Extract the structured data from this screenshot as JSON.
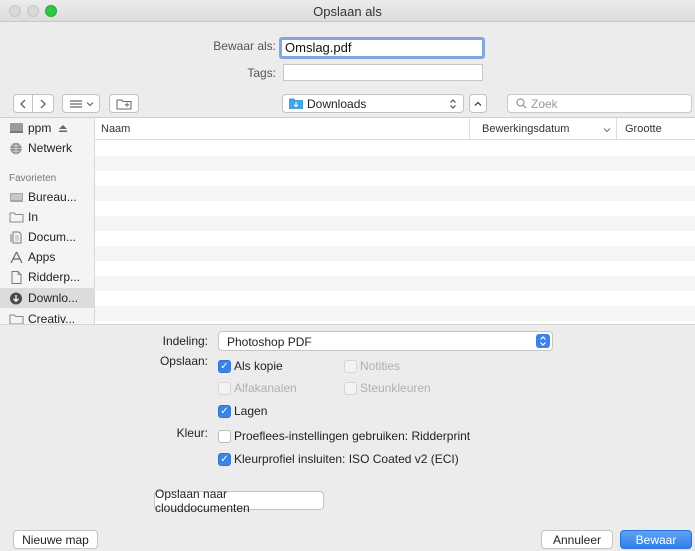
{
  "window": {
    "title": "Opslaan als"
  },
  "save": {
    "save_as_label": "Bewaar als:",
    "filename": "Omslag.pdf",
    "tags_label": "Tags:",
    "tags_value": ""
  },
  "toolbar": {
    "location": "Downloads",
    "search_placeholder": "Zoek"
  },
  "sidebar": {
    "items_top": [
      {
        "label": "ppm",
        "icon": "hard-drive-icon"
      },
      {
        "label": "Netwerk",
        "icon": "network-globe-icon"
      }
    ],
    "favorites_heading": "Favorieten",
    "favorites": [
      {
        "label": "Bureau...",
        "icon": "desktop-folder-icon"
      },
      {
        "label": "In",
        "icon": "folder-icon"
      },
      {
        "label": "Docum...",
        "icon": "documents-icon"
      },
      {
        "label": "Apps",
        "icon": "applications-icon"
      },
      {
        "label": "Ridderp...",
        "icon": "document-icon"
      },
      {
        "label": "Downlo...",
        "icon": "downloads-icon",
        "selected": true
      },
      {
        "label": "Creativ...",
        "icon": "folder-icon"
      }
    ]
  },
  "filelist": {
    "columns": [
      "Naam",
      "Bewerkingsdatum",
      "Grootte"
    ]
  },
  "options": {
    "format_label": "Indeling:",
    "format_value": "Photoshop PDF",
    "save_label": "Opslaan:",
    "as_copy": {
      "label": "Als kopie",
      "checked": true,
      "enabled": true
    },
    "notes": {
      "label": "Notities",
      "checked": false,
      "enabled": false
    },
    "alpha_channels": {
      "label": "Alfakanalen",
      "checked": false,
      "enabled": false
    },
    "spot_colors": {
      "label": "Steunkleuren",
      "checked": false,
      "enabled": false
    },
    "layers": {
      "label": "Lagen",
      "checked": true,
      "enabled": true
    },
    "color_label": "Kleur:",
    "proof_setup": {
      "label": "Proeflees-instellingen gebruiken: Ridderprint",
      "checked": false,
      "enabled": true
    },
    "embed_profile": {
      "label": "Kleurprofiel insluiten: ISO Coated v2 (ECI)",
      "checked": true,
      "enabled": true
    },
    "cloud_button": "Opslaan naar clouddocumenten"
  },
  "bottom": {
    "new_folder": "Nieuwe map",
    "cancel": "Annuleer",
    "save": "Bewaar"
  },
  "colors": {
    "accent": "#3b83e6",
    "window_bg": "#ececec",
    "focus_ring": "#7fa9dc"
  }
}
